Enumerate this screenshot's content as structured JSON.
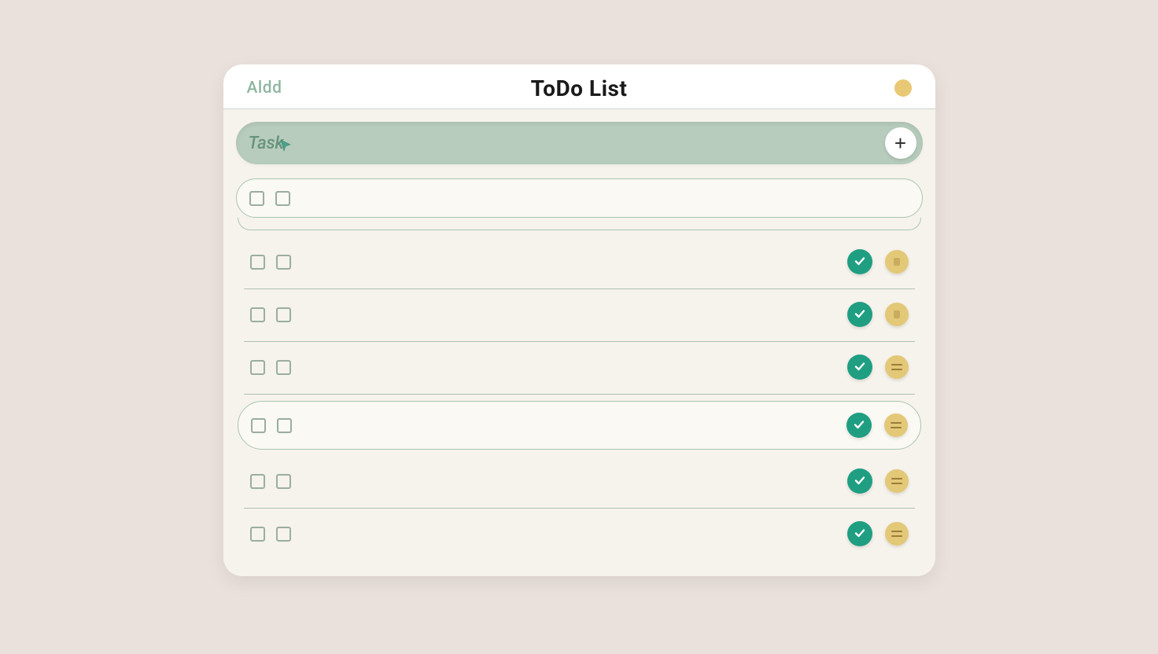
{
  "header": {
    "left_label": "Aldd",
    "title": "ToDo List",
    "dot_color": "#e8c874"
  },
  "add_task": {
    "placeholder_text": "Task",
    "add_button_label": "+"
  },
  "tasks": [
    {
      "text": "",
      "checked1": false,
      "checked2": false,
      "has_actions": false,
      "outlined": true,
      "secondary_variant": "plain"
    },
    {
      "text": "",
      "checked1": false,
      "checked2": false,
      "has_actions": true,
      "outlined": false,
      "secondary_variant": "plain"
    },
    {
      "text": "",
      "checked1": false,
      "checked2": false,
      "has_actions": true,
      "outlined": false,
      "secondary_variant": "plain"
    },
    {
      "text": "",
      "checked1": false,
      "checked2": false,
      "has_actions": true,
      "outlined": false,
      "secondary_variant": "lines"
    },
    {
      "text": "",
      "checked1": false,
      "checked2": false,
      "has_actions": true,
      "outlined": true,
      "secondary_variant": "lines"
    },
    {
      "text": "",
      "checked1": false,
      "checked2": false,
      "has_actions": true,
      "outlined": false,
      "secondary_variant": "lines"
    },
    {
      "text": "",
      "checked1": false,
      "checked2": false,
      "has_actions": true,
      "outlined": false,
      "secondary_variant": "lines"
    }
  ],
  "icons": {
    "check": "check-icon",
    "plus": "plus-icon",
    "menu_lines": "menu-lines-icon",
    "cursor": "cursor-icon",
    "dot": "status-dot-icon"
  }
}
